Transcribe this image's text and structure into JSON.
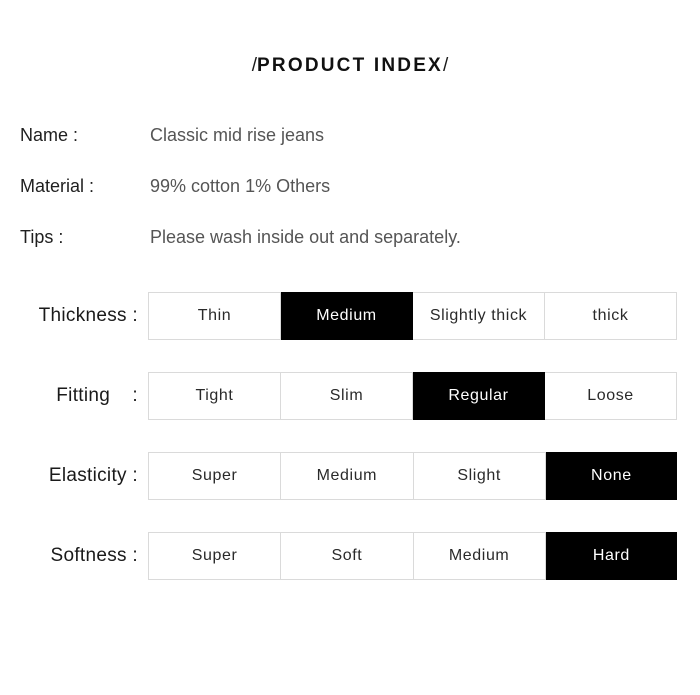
{
  "header": {
    "slash_left": "/",
    "title": "PRODUCT INDEX",
    "slash_right": "/"
  },
  "info": [
    {
      "label": "Name :",
      "value": "Classic mid rise jeans"
    },
    {
      "label": "Material :",
      "value": "99% cotton 1% Others"
    },
    {
      "label": "Tips :",
      "value": "Please wash inside out and separately."
    }
  ],
  "specs": [
    {
      "label": "Thickness :",
      "options": [
        "Thin",
        "Medium",
        "Slightly thick",
        "thick"
      ],
      "selected_index": 1,
      "selected_value": "Medium"
    },
    {
      "label": "Fitting    :",
      "options": [
        "Tight",
        "Slim",
        "Regular",
        "Loose"
      ],
      "selected_index": 2,
      "selected_value": "Regular"
    },
    {
      "label": "Elasticity :",
      "options": [
        "Super",
        "Medium",
        "Slight",
        "None"
      ],
      "selected_index": 3,
      "selected_value": "None"
    },
    {
      "label": "Softness :",
      "options": [
        "Super",
        "Soft",
        "Medium",
        "Hard"
      ],
      "selected_index": 3,
      "selected_value": "Hard"
    }
  ],
  "colors": {
    "background": "#ffffff",
    "text_dark": "#1a1a1a",
    "text_muted": "#555555",
    "cell_border": "#dadada",
    "selected_bg": "#000000",
    "selected_text": "#ffffff"
  }
}
